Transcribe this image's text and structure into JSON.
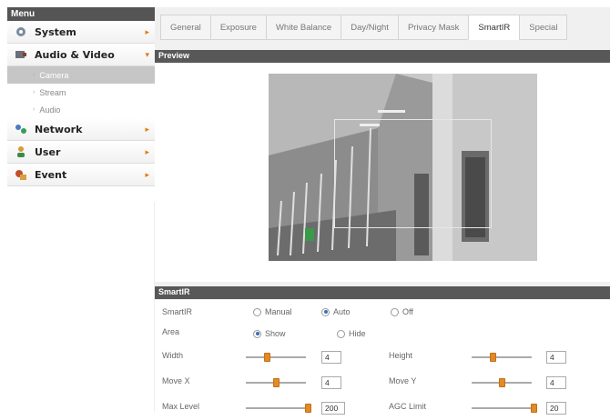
{
  "sidebar": {
    "header": "Menu",
    "items": [
      {
        "label": "System",
        "icon": "gear-icon",
        "arrow": "▸"
      },
      {
        "label": "Audio & Video",
        "icon": "film-icon",
        "arrow": "▾"
      },
      {
        "label": "Network",
        "icon": "network-icon",
        "arrow": "▸"
      },
      {
        "label": "User",
        "icon": "user-icon",
        "arrow": "▸"
      },
      {
        "label": "Event",
        "icon": "event-icon",
        "arrow": "▸"
      }
    ],
    "submenu": [
      {
        "label": "Camera",
        "active": true
      },
      {
        "label": "Stream",
        "active": false
      },
      {
        "label": "Audio",
        "active": false
      }
    ]
  },
  "tabs": [
    "General",
    "Exposure",
    "White Balance",
    "Day/Night",
    "Privacy Mask",
    "SmartIR",
    "Special"
  ],
  "active_tab": "SmartIR",
  "preview": {
    "title": "Preview"
  },
  "smartir": {
    "title": "SmartIR",
    "mode_label": "SmartIR",
    "mode_options": [
      "Manual",
      "Auto",
      "Off"
    ],
    "mode_selected": "Auto",
    "area_label": "Area",
    "area_options": [
      "Show",
      "Hide"
    ],
    "area_selected": "Show",
    "width_label": "Width",
    "width_value": "4",
    "width_level": 0.35,
    "height_label": "Height",
    "height_value": "4",
    "height_level": 0.35,
    "movex_label": "Move X",
    "movex_value": "4",
    "movex_level": 0.5,
    "movey_label": "Move Y",
    "movey_value": "4",
    "movey_level": 0.5,
    "maxlevel_label": "Max Level",
    "maxlevel_value": "200",
    "maxlevel_level": 1.0,
    "agclimit_label": "AGC Limit",
    "agclimit_value": "20",
    "agclimit_level": 1.0
  },
  "colors": {
    "accent": "#e08a2a",
    "header": "#585858"
  }
}
